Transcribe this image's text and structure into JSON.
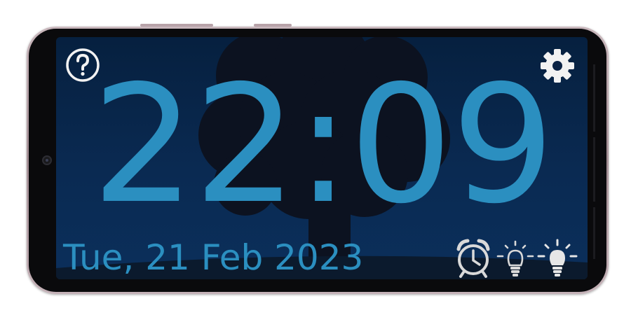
{
  "clock": {
    "time": "22:09",
    "date": "Tue, 21 Feb 2023"
  },
  "icons": {
    "help": "help-icon",
    "settings": "gear-icon",
    "alarm": "alarm-clock-icon",
    "dim_light": "bulb-dim-icon",
    "bright_light": "bulb-bright-icon"
  },
  "colors": {
    "accent": "#2b8fc0",
    "icon": "#f2f2f2",
    "background_top": "#06203f",
    "background_bottom": "#0b2f5b",
    "silhouette": "#0c1220"
  }
}
